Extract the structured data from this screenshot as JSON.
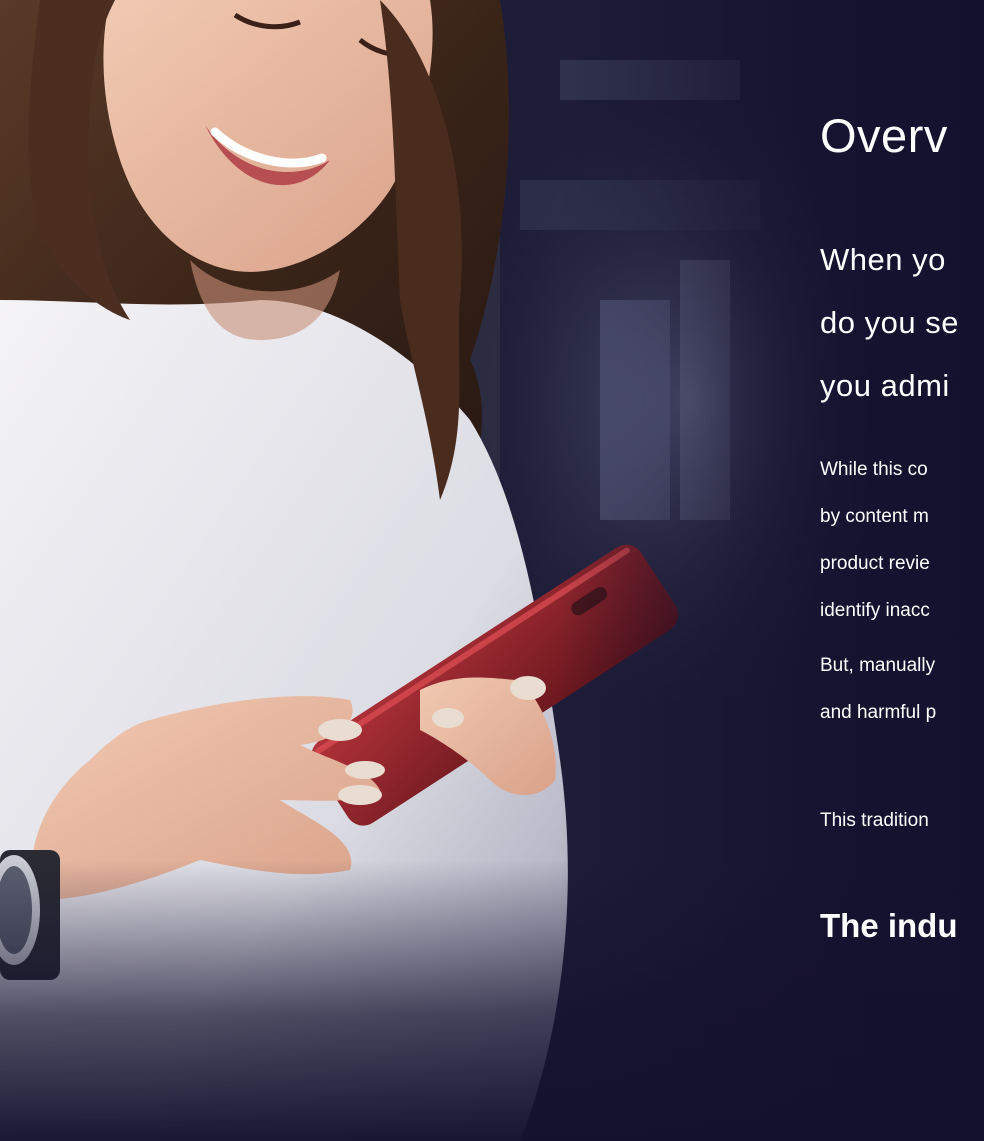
{
  "hero": {
    "image_alt": "woman-smiling-holding-phone-photo"
  },
  "overview": {
    "heading": "Overv",
    "lead_lines": [
      "When yo",
      "do you se",
      "you admi"
    ],
    "paragraph1_lines": [
      "While this co",
      "by content m",
      "product revie",
      "identify inacc"
    ],
    "paragraph2_lines": [
      "But, manually",
      "and harmful p"
    ],
    "paragraph3": "This tradition",
    "subheading": "The indu"
  },
  "colors": {
    "background": "#14112e",
    "text": "#ffffff",
    "phone": "#8a1f26"
  }
}
